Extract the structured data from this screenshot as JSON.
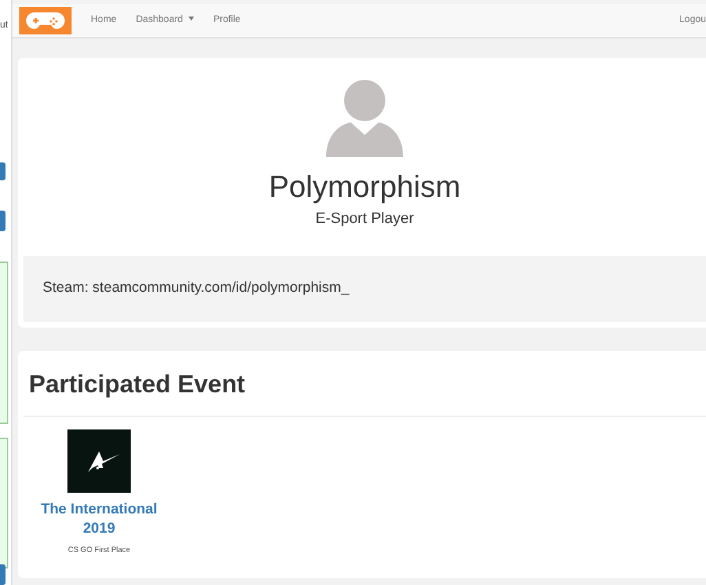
{
  "background_window": {
    "cut_text": "ut",
    "panels": [
      {
        "kind": "button"
      },
      {
        "kind": "button"
      },
      {
        "kind": "panel"
      },
      {
        "kind": "panel"
      },
      {
        "kind": "button"
      }
    ]
  },
  "navbar": {
    "links": [
      {
        "label": "Home",
        "dropdown": false
      },
      {
        "label": "Dashboard",
        "dropdown": true
      },
      {
        "label": "Profile",
        "dropdown": false
      }
    ],
    "right_link": "Logou"
  },
  "profile": {
    "name": "Polymorphism",
    "role": "E-Sport Player",
    "steam": "Steam: steamcommunity.com/id/polymorphism_"
  },
  "events_section": {
    "heading": "Participated Event",
    "events": [
      {
        "title": "The International 2019",
        "note": "CS GO First Place"
      }
    ]
  }
}
